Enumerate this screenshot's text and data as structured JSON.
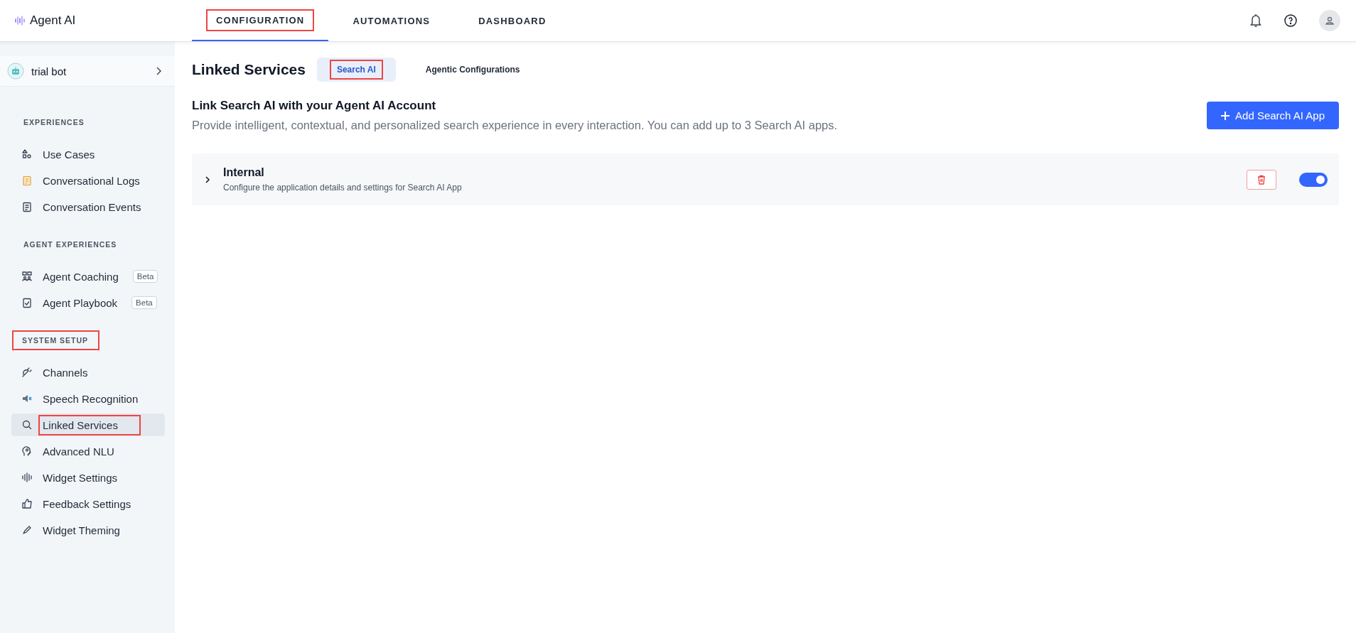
{
  "brand": "Agent AI",
  "nav_tabs": [
    {
      "label": "CONFIGURATION",
      "selected": true,
      "highlighted": true
    },
    {
      "label": "AUTOMATIONS",
      "selected": false,
      "highlighted": false
    },
    {
      "label": "DASHBOARD",
      "selected": false,
      "highlighted": false
    }
  ],
  "sidebar": {
    "bot": "trial bot",
    "sections": [
      {
        "title": "EXPERIENCES",
        "highlighted": false,
        "items": [
          {
            "label": "Use Cases",
            "selected": false,
            "highlighted": false
          },
          {
            "label": "Conversational Logs",
            "selected": false,
            "highlighted": false
          },
          {
            "label": "Conversation Events",
            "selected": false,
            "highlighted": false
          }
        ]
      },
      {
        "title": "AGENT EXPERIENCES",
        "highlighted": false,
        "items": [
          {
            "label": "Agent Coaching",
            "badge": "Beta",
            "selected": false,
            "highlighted": false
          },
          {
            "label": "Agent Playbook",
            "badge": "Beta",
            "selected": false,
            "highlighted": false
          }
        ]
      },
      {
        "title": "SYSTEM SETUP",
        "highlighted": true,
        "items": [
          {
            "label": "Channels",
            "selected": false,
            "highlighted": false
          },
          {
            "label": "Speech Recognition",
            "selected": false,
            "highlighted": false
          },
          {
            "label": "Linked Services",
            "selected": true,
            "highlighted": true
          },
          {
            "label": "Advanced NLU",
            "selected": false,
            "highlighted": false
          },
          {
            "label": "Widget Settings",
            "selected": false,
            "highlighted": false
          },
          {
            "label": "Feedback Settings",
            "selected": false,
            "highlighted": false
          },
          {
            "label": "Widget Theming",
            "selected": false,
            "highlighted": false
          }
        ]
      }
    ]
  },
  "page": {
    "title": "Linked Services",
    "tabs": [
      {
        "label": "Search AI",
        "selected": true,
        "highlighted": true
      },
      {
        "label": "Agentic Configurations",
        "selected": false,
        "highlighted": false
      }
    ],
    "heading": "Link Search AI with your Agent AI Account",
    "description": "Provide intelligent, contextual, and personalized search experience in every interaction. You can add up to 3 Search AI apps.",
    "add_button": "Add Search AI App",
    "apps": [
      {
        "name": "Internal",
        "description": "Configure the application details and settings for Search AI App",
        "expanded": false,
        "on": true
      }
    ]
  }
}
